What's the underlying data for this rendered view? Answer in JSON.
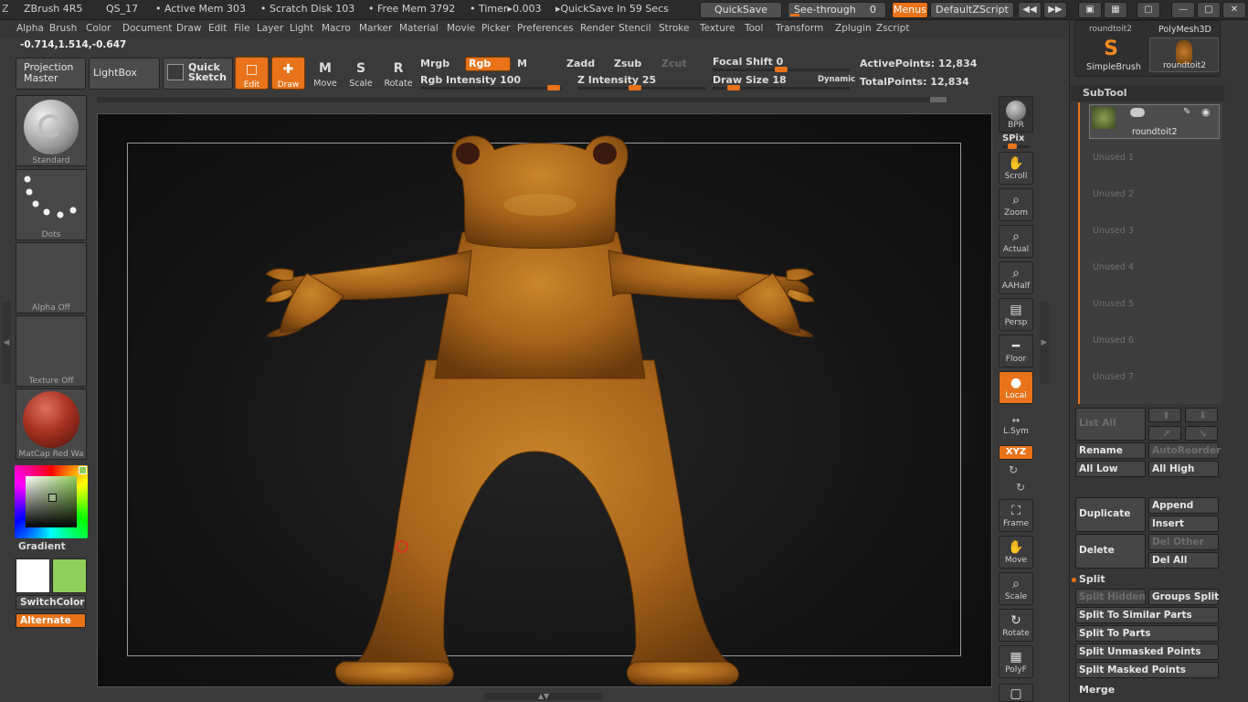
{
  "titlebar": {
    "app": "ZBrush 4R5",
    "doc": "QS_17",
    "active_mem": "• Active Mem 303",
    "scratch": "• Scratch Disk 103",
    "free_mem": "• Free Mem 3792",
    "timer": "• Timer▸0.003",
    "quicksave_info": "▸QuickSave In 59 Secs",
    "quicksave_btn": "QuickSave",
    "seethrough": "See-through",
    "seethrough_val": "0",
    "menus_btn": "Menus",
    "default_script": "DefaultZScript"
  },
  "menubar": [
    "Alpha",
    "Brush",
    "Color",
    "Document",
    "Draw",
    "Edit",
    "File",
    "Layer",
    "Light",
    "Macro",
    "Marker",
    "Material",
    "Movie",
    "Picker",
    "Preferences",
    "Render",
    "Stencil",
    "Stroke",
    "Texture",
    "Tool",
    "Transform",
    "Zplugin",
    "Zscript"
  ],
  "coords": "-0.714,1.514,-0.647",
  "shelf": {
    "projection_master": "Projection Master",
    "lightbox": "LightBox",
    "quick_sketch": "Quick Sketch",
    "edit": "Edit",
    "draw": "Draw",
    "move": "Move",
    "scale": "Scale",
    "rotate": "Rotate",
    "mrgb": "Mrgb",
    "rgb": "Rgb",
    "m": "M",
    "zadd": "Zadd",
    "zsub": "Zsub",
    "zcut": "Zcut",
    "rgb_intensity": "Rgb Intensity 100",
    "z_intensity": "Z Intensity 25",
    "focal_shift": "Focal Shift 0",
    "draw_size": "Draw Size 18",
    "dynamic": "Dynamic",
    "active_points": "ActivePoints: 12,834",
    "total_points": "TotalPoints: 12,834"
  },
  "left": {
    "brush_cap": "Standard",
    "stroke_cap": "Dots",
    "alpha_cap": "Alpha  Off",
    "texture_cap": "Texture  Off",
    "material_cap": "MatCap  Red  Wa",
    "gradient": "Gradient",
    "switchcolor": "SwitchColor",
    "alternate": "Alternate"
  },
  "righttools": {
    "bpr": "BPR",
    "spix": "SPix",
    "scroll": "Scroll",
    "zoom": "Zoom",
    "actual": "Actual",
    "aahalf": "AAHalf",
    "persp": "Persp",
    "floor": "Floor",
    "local": "Local",
    "lsym": "L.Sym",
    "xyz": "XYZ",
    "frame": "Frame",
    "move": "Move",
    "scale": "Scale",
    "rotate": "Rotate",
    "polyf": "PolyF"
  },
  "rightpanel": {
    "top_thumb1": "roundtoit2",
    "polymesh": "PolyMesh3D",
    "simplebrush": "SimpleBrush",
    "roundtoit2": "roundtoit2",
    "subtool_title": "SubTool",
    "subtool_name": "roundtoit2",
    "unused": [
      "Unused 1",
      "Unused 2",
      "Unused 3",
      "Unused 4",
      "Unused 5",
      "Unused 6",
      "Unused 7"
    ],
    "list_all": "List All",
    "rename": "Rename",
    "autoreorder": "AutoReorder",
    "all_low": "All Low",
    "all_high": "All High",
    "duplicate": "Duplicate",
    "append": "Append",
    "insert": "Insert",
    "delete": "Delete",
    "del_other": "Del Other",
    "del_all": "Del All",
    "split_title": "Split",
    "split_hidden": "Split Hidden",
    "groups_split": "Groups Split",
    "split_similar": "Split To Similar Parts",
    "split_parts": "Split To Parts",
    "split_unmasked": "Split Unmasked Points",
    "split_masked": "Split Masked Points",
    "merge": "Merge"
  },
  "colors": {
    "accent": "#e8731a",
    "model": "#b56a1c",
    "secondary_swatch": "#8fce5a"
  }
}
